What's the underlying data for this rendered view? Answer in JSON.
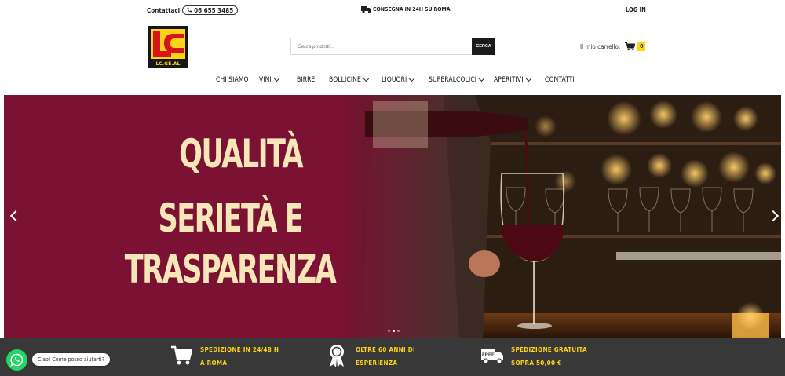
{
  "topbar": {
    "contact_label": "Contattaci",
    "phone": "06 655 3485",
    "shipping": "CONSEGNA IN 24H SU ROMA",
    "login": "LOG IN"
  },
  "header": {
    "logo_caption": "LC.GE.AL",
    "search_placeholder": "Cerca prodotti…",
    "search_button": "CERCA",
    "cart_label": "Il mio carrello:",
    "cart_count": "0"
  },
  "nav": [
    {
      "label": "CHI SIAMO",
      "dropdown": false
    },
    {
      "label": "VINI",
      "dropdown": true
    },
    {
      "label": "BIRRE",
      "dropdown": false
    },
    {
      "label": "BOLLICINE",
      "dropdown": true
    },
    {
      "label": "LIQUORI",
      "dropdown": true
    },
    {
      "label": "SUPERALCOLICI",
      "dropdown": true
    },
    {
      "label": "APERITIVI",
      "dropdown": true
    },
    {
      "label": "CONTATTI",
      "dropdown": false
    }
  ],
  "hero": {
    "lines": [
      "QUALITÀ",
      "SERIETÀ E",
      "TRASPARENZA"
    ],
    "slides": 3,
    "active_slide": 2
  },
  "features": [
    {
      "icon": "cart-icon",
      "text": "SPEDIZIONE IN 24/48 H\nA ROMA"
    },
    {
      "icon": "award-ribbon-icon",
      "text": "OLTRE 60 ANNI DI\nESPERIENZA"
    },
    {
      "icon": "free-shipping-truck-icon",
      "text": "SPEDIZIONE GRATUITA\nSOPRA 50,00 €",
      "badge": "FREE"
    }
  ],
  "chat": {
    "message": "Ciao! Come posso aiutarti?"
  },
  "colors": {
    "brand_yellow": "#ffd21a",
    "hero_burgundy": "#7b1133",
    "hero_text": "#f6e6b8",
    "features_bg": "#383838",
    "whatsapp_green": "#25d366"
  }
}
